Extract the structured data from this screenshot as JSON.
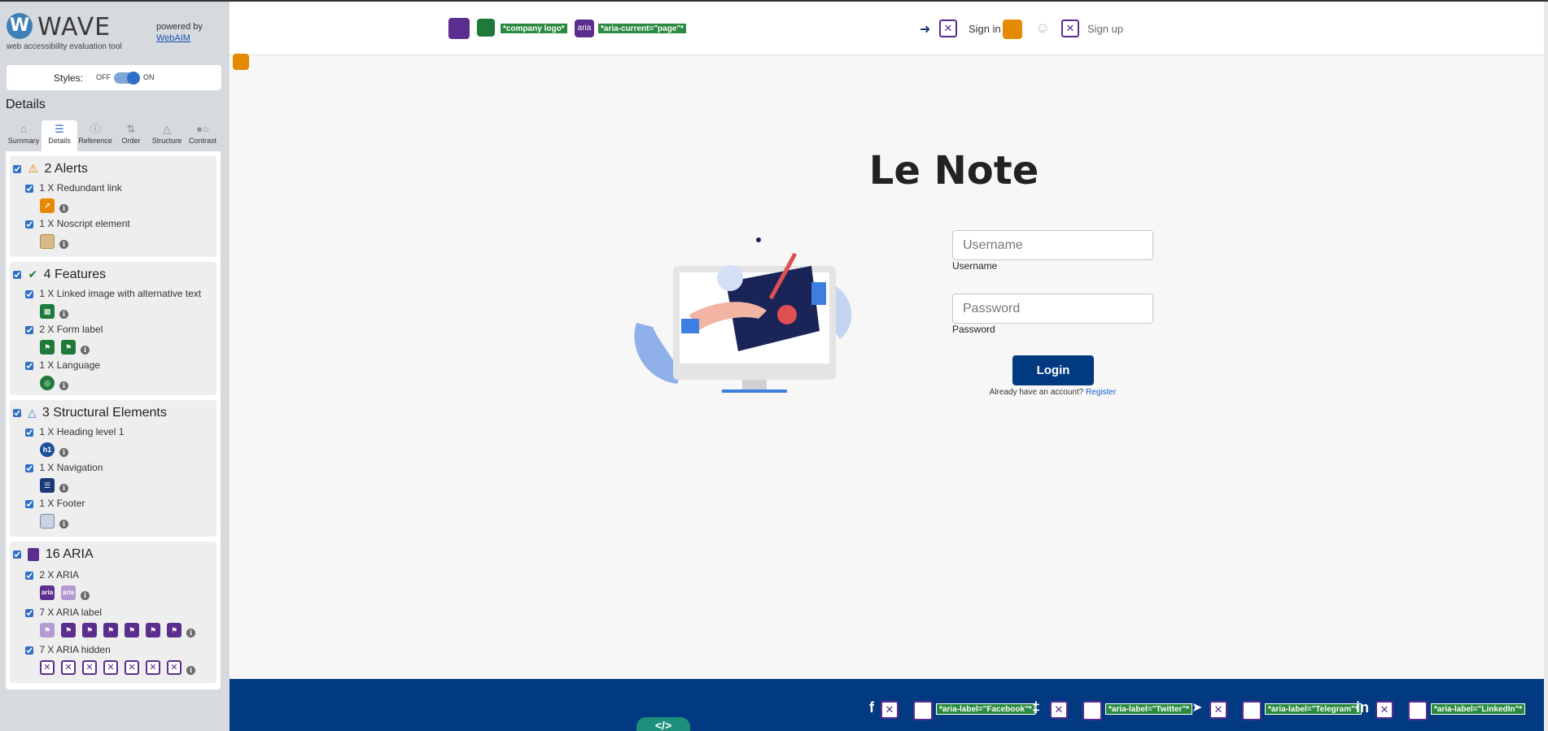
{
  "wave": {
    "brand": "WAVE",
    "tagline": "web accessibility evaluation tool",
    "powered_by": "powered by",
    "webaim": "WebAIM",
    "styles_label": "Styles:",
    "toggle_off": "OFF",
    "toggle_on": "ON",
    "details_title": "Details",
    "tabs": [
      {
        "label": "Summary",
        "icon": "home-icon"
      },
      {
        "label": "Details",
        "icon": "list-icon"
      },
      {
        "label": "Reference",
        "icon": "info-icon"
      },
      {
        "label": "Order",
        "icon": "order-icon"
      },
      {
        "label": "Structure",
        "icon": "structure-icon"
      },
      {
        "label": "Contrast",
        "icon": "contrast-icon"
      }
    ],
    "groups": {
      "alerts": {
        "title": "2 Alerts",
        "items": [
          {
            "label": "1 X Redundant link"
          },
          {
            "label": "1 X Noscript element"
          }
        ]
      },
      "features": {
        "title": "4 Features",
        "items": [
          {
            "label": "1 X Linked image with alternative text"
          },
          {
            "label": "2 X Form label"
          },
          {
            "label": "1 X Language"
          }
        ]
      },
      "structural": {
        "title": "3 Structural Elements",
        "items": [
          {
            "label": "1 X Heading level 1"
          },
          {
            "label": "1 X Navigation"
          },
          {
            "label": "1 X Footer"
          }
        ]
      },
      "aria": {
        "title": "16 ARIA",
        "items": [
          {
            "label": "2 X ARIA"
          },
          {
            "label": "7 X ARIA label"
          },
          {
            "label": "7 X ARIA hidden"
          }
        ]
      }
    },
    "colors": {
      "sidebar_bg": "#d6d9de",
      "accent": "#2f6fc6",
      "alert": "#e58a00",
      "feature": "#1f7a3a",
      "aria": "#5b2d8e"
    }
  },
  "site": {
    "nav": {
      "tag_company_logo": "*company logo*",
      "aria_badge": "aria",
      "tag_aria_current": "*aria-current=\"page\"*",
      "sign_in": "Sign in",
      "sign_up": "Sign up"
    },
    "title": "Le Note",
    "form": {
      "username_placeholder": "Username",
      "username_label": "Username",
      "password_placeholder": "Password",
      "password_label": "Password",
      "login_button": "Login",
      "already_text": "Already have an account?",
      "register_link": "Register"
    },
    "footer": {
      "facebook_icon": "f",
      "twitter_icon": "‡",
      "telegram_icon": "➤",
      "linkedin_icon": "in",
      "aria_facebook": "*aria-label=\"Facebook\"*",
      "aria_twitter": "*aria-label=\"Twitter\"*",
      "aria_telegram": "*aria-label=\"Telegram\"*",
      "aria_linkedin": "*aria-label=\"LinkedIn\"*",
      "code_button": "</>"
    },
    "colors": {
      "footer_bg": "#023a82",
      "button_bg": "#023a82",
      "page_bg": "#f7f7f7"
    }
  }
}
